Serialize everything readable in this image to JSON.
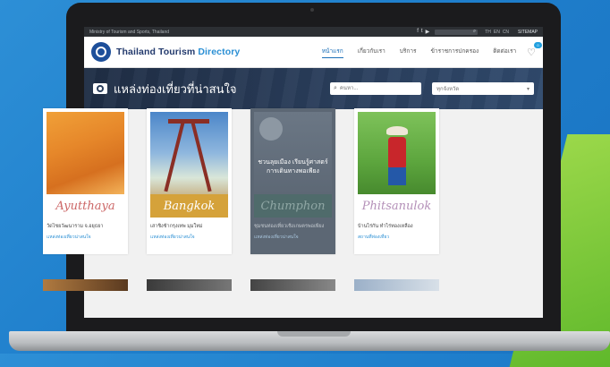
{
  "topbar": {
    "ministry": "Ministry of Tourism and Sports, Thailand",
    "social": [
      "f",
      "t",
      "▶"
    ],
    "langs": [
      "TH",
      "EN",
      "CN"
    ],
    "sitemap": "SITEMAP"
  },
  "header": {
    "brand_main": "Thailand Tourism ",
    "brand_dir": "Directory",
    "nav": [
      "หน้าแรก",
      "เกี่ยวกับเรา",
      "บริการ",
      "ข้าราชการปกครอง",
      "ติดต่อเรา"
    ],
    "badge": "0"
  },
  "banner": {
    "title": "แหล่งท่องเที่ยวที่น่าสนใจ",
    "search_placeholder": "ค้นหา...",
    "select_value": "ทุกจังหวัด"
  },
  "cards": [
    {
      "plate": "Ayutthaya",
      "caption": "วัดไชยวัฒนาราม จ.อยุธยา",
      "link": "แหล่งท่องเที่ยวน่าสนใจ"
    },
    {
      "plate": "Bangkok",
      "caption": "เสาชิงช้ากรุงเทพ มุมใหม่",
      "link": "แหล่งท่องเที่ยวน่าสนใจ"
    },
    {
      "plate": "Chumphon",
      "overlay": "ชวนลุยเมือง เรียนรู้ศาสตร์การเดินทางพอเพียง",
      "caption": "ชุมชนท่องเที่ยวเชิงเกษตรพอเพียง",
      "link": "แหล่งท่องเที่ยวน่าสนใจ"
    },
    {
      "plate": "Phitsanulok",
      "caption": "บ้านไร่กัน ทำไร่ทองเหลือง",
      "link": "สถานที่ท่องเที่ยว"
    }
  ],
  "colors": {
    "accent": "#2a8fd4",
    "brand": "#233a6d",
    "banner": "#2a3e5c"
  }
}
